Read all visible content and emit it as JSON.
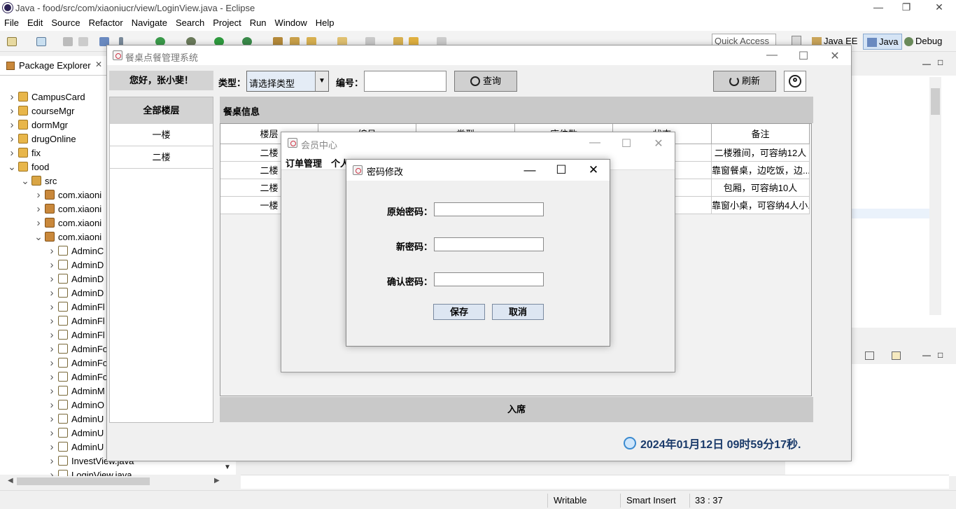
{
  "eclipse": {
    "title": "Java - food/src/com/xiaoniucr/view/LoginView.java - Eclipse",
    "menu": [
      "File",
      "Edit",
      "Source",
      "Refactor",
      "Navigate",
      "Search",
      "Project",
      "Run",
      "Window",
      "Help"
    ],
    "quick_access": "Quick Access",
    "perspectives": [
      "Java EE",
      "Java",
      "Debug"
    ],
    "package_explorer_tab": "Package Explorer",
    "tree": [
      {
        "label": "CampusCard",
        "depth": 0,
        "icon": "project",
        "expanded": false
      },
      {
        "label": "courseMgr",
        "depth": 0,
        "icon": "project",
        "expanded": false
      },
      {
        "label": "dormMgr",
        "depth": 0,
        "icon": "project",
        "expanded": false
      },
      {
        "label": "drugOnline",
        "depth": 0,
        "icon": "project",
        "expanded": false
      },
      {
        "label": "fix",
        "depth": 0,
        "icon": "project",
        "expanded": false
      },
      {
        "label": "food",
        "depth": 0,
        "icon": "project",
        "expanded": true
      },
      {
        "label": "src",
        "depth": 1,
        "icon": "source-folder",
        "expanded": true
      },
      {
        "label": "com.xiaoni",
        "depth": 2,
        "icon": "package",
        "expanded": false
      },
      {
        "label": "com.xiaoni",
        "depth": 2,
        "icon": "package",
        "expanded": false
      },
      {
        "label": "com.xiaoni",
        "depth": 2,
        "icon": "package",
        "expanded": false
      },
      {
        "label": "com.xiaoni",
        "depth": 2,
        "icon": "package",
        "expanded": true
      },
      {
        "label": "AdminC",
        "depth": 3,
        "icon": "java-file",
        "expanded": false
      },
      {
        "label": "AdminD",
        "depth": 3,
        "icon": "java-file",
        "expanded": false
      },
      {
        "label": "AdminD",
        "depth": 3,
        "icon": "java-file",
        "expanded": false
      },
      {
        "label": "AdminD",
        "depth": 3,
        "icon": "java-file",
        "expanded": false
      },
      {
        "label": "AdminFl",
        "depth": 3,
        "icon": "java-file",
        "expanded": false
      },
      {
        "label": "AdminFl",
        "depth": 3,
        "icon": "java-file",
        "expanded": false
      },
      {
        "label": "AdminFl",
        "depth": 3,
        "icon": "java-file",
        "expanded": false
      },
      {
        "label": "AdminFo",
        "depth": 3,
        "icon": "java-file",
        "expanded": false
      },
      {
        "label": "AdminFo",
        "depth": 3,
        "icon": "java-file",
        "expanded": false
      },
      {
        "label": "AdminFo",
        "depth": 3,
        "icon": "java-file",
        "expanded": false
      },
      {
        "label": "AdminM",
        "depth": 3,
        "icon": "java-file",
        "expanded": false
      },
      {
        "label": "AdminO",
        "depth": 3,
        "icon": "java-file",
        "expanded": false
      },
      {
        "label": "AdminU",
        "depth": 3,
        "icon": "java-file",
        "expanded": false
      },
      {
        "label": "AdminU",
        "depth": 3,
        "icon": "java-file",
        "expanded": false
      },
      {
        "label": "AdminU",
        "depth": 3,
        "icon": "java-file",
        "expanded": false
      },
      {
        "label": "InvestView.java",
        "depth": 3,
        "icon": "java-file",
        "expanded": false
      },
      {
        "label": "LoginView.java",
        "depth": 3,
        "icon": "java-file",
        "expanded": false
      }
    ],
    "status": {
      "writable": "Writable",
      "insert_mode": "Smart Insert",
      "position": "33 : 37"
    }
  },
  "main": {
    "title": "餐桌点餐管理系统",
    "greeting": "您好，张小斐！",
    "type_label": "类型：",
    "type_value": "请选择类型",
    "number_label": "编号：",
    "number_value": "",
    "query_button": "查询",
    "refresh_button": "刷新",
    "floor_all": "全部楼层",
    "floors": [
      "一楼",
      "二楼"
    ],
    "table_section_title": "餐桌信息",
    "columns": [
      "楼层",
      "编号",
      "类型",
      "座位数",
      "状态",
      "备注"
    ],
    "rows": [
      [
        "二楼",
        "",
        "",
        "",
        "",
        "二楼雅间，可容纳12人"
      ],
      [
        "二楼",
        "",
        "",
        "",
        "",
        "靠窗餐桌，边吃饭，边..."
      ],
      [
        "二楼",
        "",
        "",
        "",
        "",
        "包厢，可容纳10人"
      ],
      [
        "一楼",
        "",
        "",
        "",
        "",
        "靠窗小桌，可容纳4人小..."
      ]
    ],
    "seat_button": "入席",
    "clock_text": "2024年01月12日 09时59分17秒."
  },
  "member_center": {
    "title": "会员中心",
    "menu": [
      "订单管理",
      "个人设置"
    ]
  },
  "password_dialog": {
    "title": "密码修改",
    "old_label": "原始密码：",
    "new_label": "新密码：",
    "confirm_label": "确认密码：",
    "old_value": "",
    "new_value": "",
    "confirm_value": "",
    "save_button": "保存",
    "cancel_button": "取消"
  }
}
